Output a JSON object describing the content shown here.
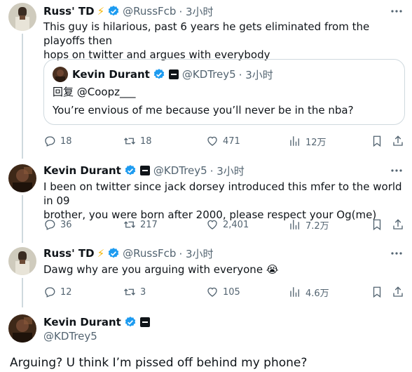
{
  "colors": {
    "accent": "#1d9bf0",
    "text": "#0f1419",
    "muted": "#536471",
    "lightning": "#f4b400"
  },
  "tweets": [
    {
      "name": "Russ' TD",
      "badge": "⚡",
      "handle": "@RussFcb",
      "time": "· 3小时",
      "lines": [
        "This guy is hilarious, past 6 years he gets eliminated from the playoffs then",
        "hops on twitter and argues with everybody"
      ],
      "quote": {
        "name": "Kevin Durant",
        "handle": "@KDTrey5",
        "time": "· 3小时",
        "reply_to": "回复 @Coopz___",
        "text": "You’re envious of me because you’ll never be in the nba?"
      },
      "stats": {
        "replies": "18",
        "retweets": "18",
        "likes": "471",
        "views": "12万"
      }
    },
    {
      "name": "Kevin Durant",
      "handle": "@KDTrey5",
      "time": "· 3小时",
      "lines": [
        "I been on twitter since jack dorsey introduced this mfer to the world in 09",
        "brother, you were born after 2000, please respect your Og(me)"
      ],
      "stats": {
        "replies": "36",
        "retweets": "217",
        "likes": "2,401",
        "views": "7.2万"
      }
    },
    {
      "name": "Russ' TD",
      "badge": "⚡",
      "handle": "@RussFcb",
      "time": "· 3小时",
      "lines": [
        "Dawg why are you arguing with everyone 😭"
      ],
      "stats": {
        "replies": "12",
        "retweets": "3",
        "likes": "105",
        "views": "4.6万"
      }
    }
  ],
  "main_tweet": {
    "name": "Kevin Durant",
    "handle": "@KDTrey5",
    "text": "Arguing? U think I’m pissed off behind my phone?"
  }
}
